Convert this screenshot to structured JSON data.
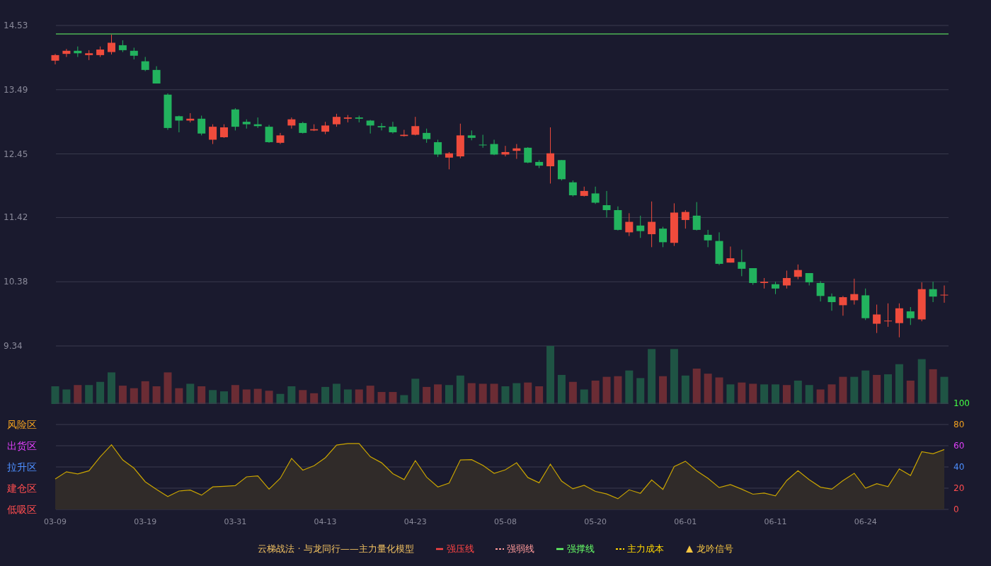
{
  "price_chart": {
    "chart_data": {
      "type": "candlestick",
      "ylim": [
        9.34,
        14.53
      ],
      "yticks": [
        9.34,
        10.38,
        11.42,
        12.45,
        13.49,
        14.53
      ],
      "grid": true,
      "ohlc": [
        [
          13.96,
          14.07,
          13.9,
          14.05
        ],
        [
          14.07,
          14.15,
          14.02,
          14.12
        ],
        [
          14.12,
          14.19,
          14.02,
          14.08
        ],
        [
          14.05,
          14.13,
          13.97,
          14.08
        ],
        [
          14.05,
          14.19,
          14.02,
          14.14
        ],
        [
          14.1,
          14.38,
          14.06,
          14.25
        ],
        [
          14.21,
          14.29,
          14.1,
          14.13
        ],
        [
          14.12,
          14.17,
          13.98,
          14.04
        ],
        [
          13.95,
          14.02,
          13.79,
          13.81
        ],
        [
          13.81,
          13.87,
          13.59,
          13.59
        ],
        [
          13.41,
          13.43,
          12.84,
          12.87
        ],
        [
          13.06,
          13.07,
          12.8,
          12.99
        ],
        [
          12.99,
          13.11,
          12.96,
          13.02
        ],
        [
          13.02,
          13.07,
          12.75,
          12.78
        ],
        [
          12.68,
          12.93,
          12.61,
          12.89
        ],
        [
          12.72,
          12.93,
          12.71,
          12.88
        ],
        [
          13.17,
          13.19,
          12.83,
          12.89
        ],
        [
          12.97,
          13.01,
          12.86,
          12.93
        ],
        [
          12.93,
          13.04,
          12.87,
          12.9
        ],
        [
          12.89,
          12.92,
          12.63,
          12.64
        ],
        [
          12.63,
          12.79,
          12.61,
          12.75
        ],
        [
          12.91,
          13.04,
          12.86,
          13.01
        ],
        [
          12.95,
          12.97,
          12.78,
          12.79
        ],
        [
          12.83,
          12.93,
          12.82,
          12.85
        ],
        [
          12.81,
          12.97,
          12.77,
          12.91
        ],
        [
          12.93,
          13.1,
          12.89,
          13.05
        ],
        [
          13.02,
          13.08,
          12.96,
          13.04
        ],
        [
          13.04,
          13.07,
          12.96,
          13.02
        ],
        [
          12.99,
          13.0,
          12.78,
          12.91
        ],
        [
          12.9,
          12.95,
          12.83,
          12.88
        ],
        [
          12.89,
          12.97,
          12.78,
          12.8
        ],
        [
          12.74,
          12.84,
          12.73,
          12.76
        ],
        [
          12.76,
          13.05,
          12.75,
          12.9
        ],
        [
          12.79,
          12.86,
          12.63,
          12.69
        ],
        [
          12.64,
          12.68,
          12.4,
          12.44
        ],
        [
          12.39,
          12.48,
          12.2,
          12.46
        ],
        [
          12.41,
          12.94,
          12.38,
          12.75
        ],
        [
          12.75,
          12.83,
          12.67,
          12.71
        ],
        [
          12.6,
          12.76,
          12.55,
          12.59
        ],
        [
          12.61,
          12.68,
          12.43,
          12.44
        ],
        [
          12.44,
          12.58,
          12.41,
          12.48
        ],
        [
          12.5,
          12.61,
          12.37,
          12.54
        ],
        [
          12.55,
          12.56,
          12.3,
          12.31
        ],
        [
          12.32,
          12.35,
          12.22,
          12.26
        ],
        [
          12.25,
          12.88,
          11.97,
          12.46
        ],
        [
          12.35,
          12.35,
          12.02,
          12.04
        ],
        [
          11.99,
          12.02,
          11.76,
          11.78
        ],
        [
          11.77,
          11.92,
          11.76,
          11.85
        ],
        [
          11.81,
          11.92,
          11.64,
          11.66
        ],
        [
          11.62,
          11.85,
          11.42,
          11.54
        ],
        [
          11.54,
          11.6,
          11.21,
          11.22
        ],
        [
          11.18,
          11.49,
          11.12,
          11.35
        ],
        [
          11.29,
          11.45,
          11.09,
          11.2
        ],
        [
          11.15,
          11.68,
          10.94,
          11.35
        ],
        [
          11.24,
          11.27,
          10.94,
          11.02
        ],
        [
          11.01,
          11.65,
          10.96,
          11.5
        ],
        [
          11.38,
          11.54,
          11.24,
          11.51
        ],
        [
          11.45,
          11.67,
          11.21,
          11.22
        ],
        [
          11.14,
          11.22,
          10.94,
          11.05
        ],
        [
          11.04,
          11.18,
          10.65,
          10.67
        ],
        [
          10.69,
          10.95,
          10.69,
          10.76
        ],
        [
          10.7,
          10.9,
          10.47,
          10.59
        ],
        [
          10.6,
          10.6,
          10.33,
          10.36
        ],
        [
          10.36,
          10.44,
          10.27,
          10.38
        ],
        [
          10.34,
          10.38,
          10.18,
          10.27
        ],
        [
          10.32,
          10.56,
          10.27,
          10.44
        ],
        [
          10.46,
          10.66,
          10.42,
          10.57
        ],
        [
          10.52,
          10.52,
          10.32,
          10.37
        ],
        [
          10.36,
          10.39,
          10.06,
          10.15
        ],
        [
          10.14,
          10.19,
          9.91,
          10.05
        ],
        [
          10.0,
          10.15,
          9.83,
          10.13
        ],
        [
          10.08,
          10.43,
          10.01,
          10.18
        ],
        [
          10.16,
          10.27,
          9.76,
          9.79
        ],
        [
          9.7,
          10.01,
          9.55,
          9.85
        ],
        [
          9.74,
          10.03,
          9.65,
          9.75
        ],
        [
          9.71,
          10.03,
          9.48,
          9.95
        ],
        [
          9.9,
          9.97,
          9.68,
          9.79
        ],
        [
          9.77,
          10.37,
          9.74,
          10.26
        ],
        [
          10.26,
          10.38,
          10.05,
          10.14
        ],
        [
          10.16,
          10.32,
          10.04,
          10.17
        ]
      ]
    }
  },
  "indicator": {
    "zones": [
      {
        "label": "风险区",
        "color": "#f0a020"
      },
      {
        "label": "出货区",
        "color": "#e040fb"
      },
      {
        "label": "拉升区",
        "color": "#4d8fff"
      },
      {
        "label": "建仓区",
        "color": "#ff4d4f"
      },
      {
        "label": "低吸区",
        "color": "#ff4d4f"
      }
    ],
    "right_ticks": [
      {
        "label": "100",
        "color": "#44ff44"
      },
      {
        "label": "80",
        "color": "#f0a020"
      },
      {
        "label": "60",
        "color": "#e040fb"
      },
      {
        "label": "40",
        "color": "#4d8fff"
      },
      {
        "label": "20",
        "color": "#ff4d4f"
      },
      {
        "label": "0",
        "color": "#ff4d4f"
      }
    ],
    "chart_data": {
      "type": "area",
      "ylim": [
        0,
        100
      ],
      "yticks": [
        100,
        80,
        60,
        40,
        20,
        0
      ],
      "grid": true,
      "categories": [
        "03-09",
        null,
        null,
        null,
        null,
        null,
        null,
        null,
        "03-19",
        null,
        null,
        null,
        null,
        null,
        null,
        null,
        "03-31",
        null,
        null,
        null,
        null,
        null,
        null,
        null,
        "04-13",
        null,
        null,
        null,
        null,
        null,
        null,
        null,
        "04-23",
        null,
        null,
        null,
        null,
        null,
        null,
        null,
        "05-08",
        null,
        null,
        null,
        null,
        null,
        null,
        null,
        "05-20",
        null,
        null,
        null,
        null,
        null,
        null,
        null,
        "06-01",
        null,
        null,
        null,
        null,
        null,
        null,
        null,
        "06-11",
        null,
        null,
        null,
        null,
        null,
        null,
        null,
        "06-24",
        null,
        null,
        null,
        null,
        null,
        null,
        null
      ],
      "series": [
        {
          "color": "#c9a400",
          "values": [
            28.7,
            35.5,
            33.4,
            36.4,
            49.6,
            60.9,
            46.6,
            38.8,
            26.0,
            18.8,
            12.2,
            17.3,
            18.2,
            13.4,
            21.2,
            21.8,
            22.4,
            30.7,
            31.6,
            19.1,
            29.3,
            48.1,
            37.0,
            41.2,
            48.7,
            60.6,
            62.1,
            62.1,
            49.6,
            43.9,
            33.7,
            28.1,
            46.0,
            30.4,
            21.2,
            24.8,
            46.6,
            46.9,
            41.5,
            34.0,
            37.3,
            43.9,
            30.1,
            25.1,
            42.7,
            26.6,
            19.4,
            22.7,
            17.0,
            14.6,
            10.1,
            18.5,
            15.2,
            27.8,
            18.8,
            40.3,
            45.4,
            36.4,
            29.3,
            20.6,
            23.3,
            19.1,
            14.3,
            15.5,
            12.8,
            27.2,
            36.4,
            28.1,
            20.9,
            19.1,
            27.2,
            34.0,
            20.0,
            24.2,
            21.5,
            38.2,
            31.9,
            54.3,
            52.5,
            56.4
          ]
        }
      ]
    }
  },
  "legend": {
    "title": "云梯战法 · 与龙同行——主力量化模型",
    "items": [
      {
        "label": "强压线",
        "kind": "solid",
        "color": "#ff4444"
      },
      {
        "label": "强弱线",
        "kind": "dashed",
        "color": "#ff9a9a"
      },
      {
        "label": "强撑线",
        "kind": "solid",
        "color": "#66ff66"
      },
      {
        "label": "主力成本",
        "kind": "dashed",
        "color": "#ffd700"
      },
      {
        "label": "龙吟信号",
        "kind": "triangle",
        "color": "#f5c542"
      }
    ]
  }
}
